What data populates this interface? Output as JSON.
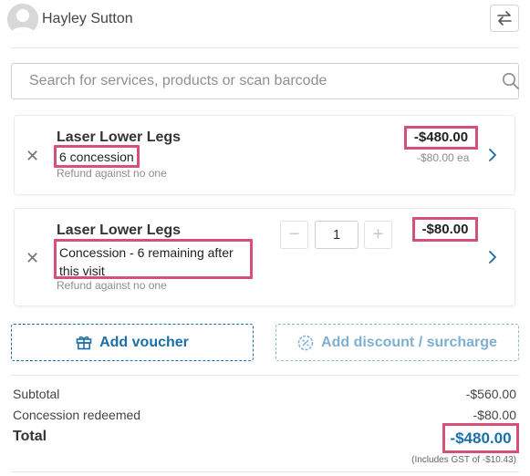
{
  "header": {
    "client_name": "Hayley Sutton",
    "avatar_icon": "user-avatar-icon",
    "swap_icon": "swap-arrows-icon"
  },
  "search": {
    "placeholder": "Search for services, products or scan barcode",
    "icon": "search-icon"
  },
  "items": [
    {
      "name": "Laser Lower Legs",
      "concession_label": "6 concession",
      "refund_note": "Refund against no one",
      "price": "-$480.00",
      "unit_price": "-$80.00 ea",
      "remove_icon": "close-icon",
      "open_icon": "chevron-right-icon"
    },
    {
      "name": "Laser Lower Legs",
      "concession_label": "Concession - 6 remaining after this visit",
      "refund_note": "Refund against no one",
      "price": "-$80.00",
      "quantity": "1",
      "decrement_label": "−",
      "increment_label": "+",
      "remove_icon": "close-icon",
      "open_icon": "chevron-right-icon"
    }
  ],
  "actions": {
    "add_voucher": "Add voucher",
    "add_voucher_icon": "gift-icon",
    "add_discount": "Add discount / surcharge",
    "add_discount_icon": "discount-badge-icon"
  },
  "totals": {
    "subtotal_label": "Subtotal",
    "subtotal_value": "-$560.00",
    "concession_label": "Concession redeemed",
    "concession_value": "-$80.00",
    "total_label": "Total",
    "total_value": "-$480.00",
    "gst_note": "(Includes GST of -$10.43)"
  },
  "colors": {
    "accent": "#1a6fa8",
    "accent_light": "#7fb0d2",
    "highlight": "#d6517a"
  }
}
